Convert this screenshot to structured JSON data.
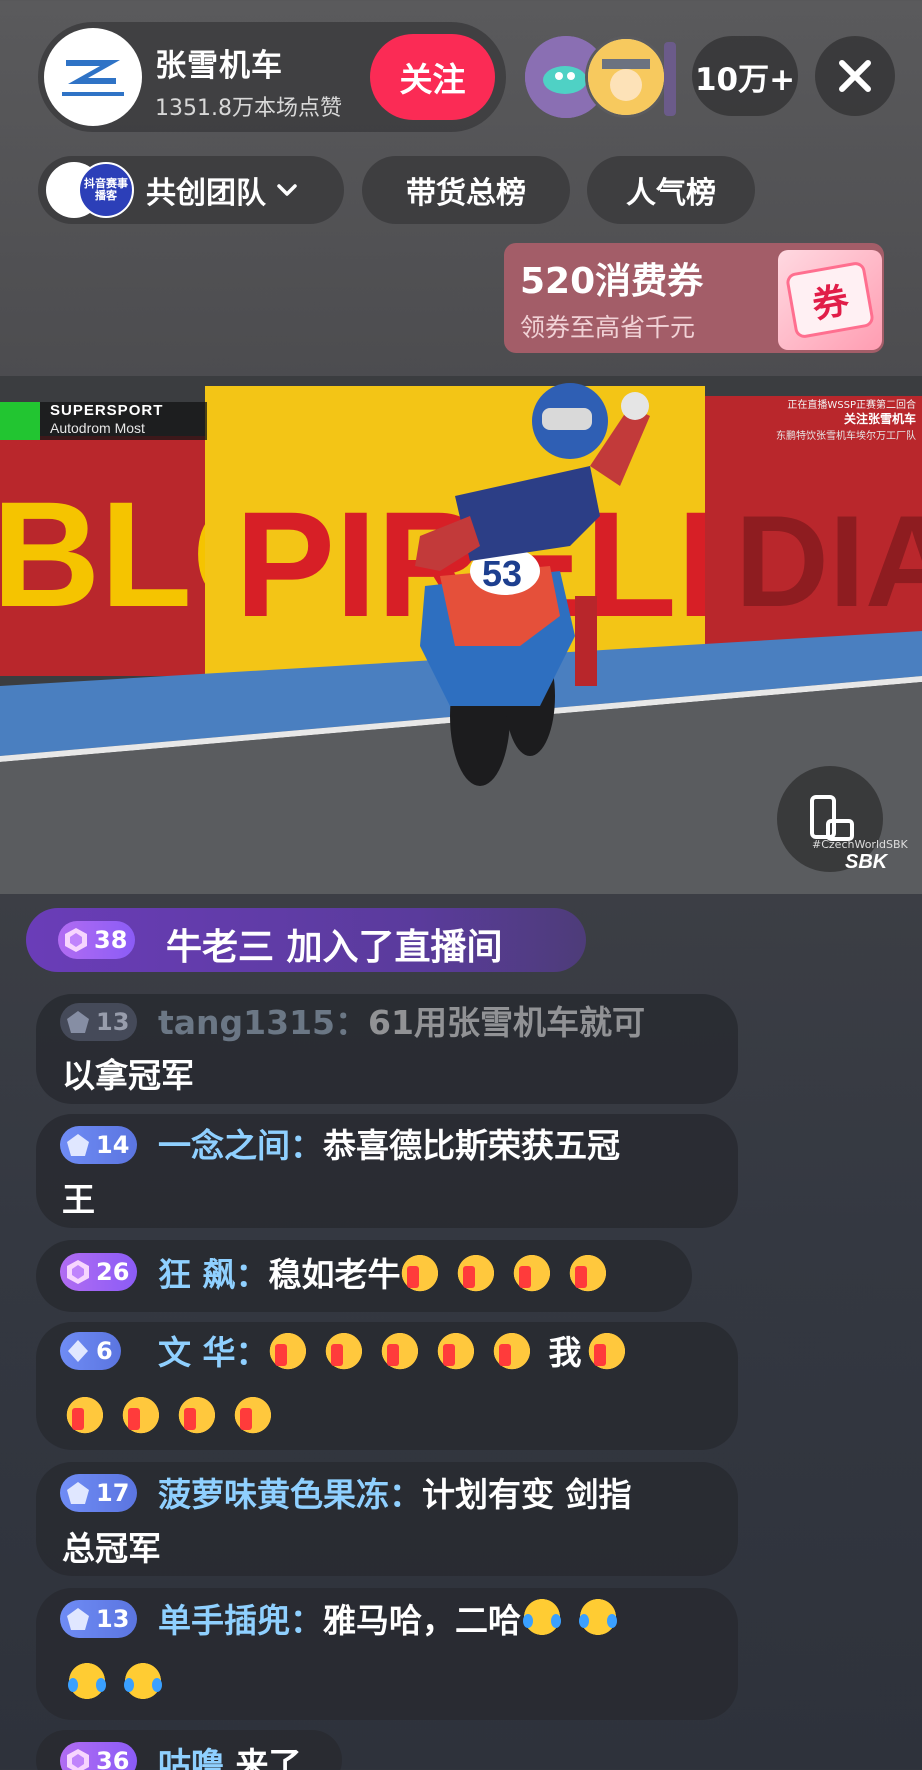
{
  "header": {
    "anchor_name": "张雪机车",
    "anchor_likes": "1351.8万本场点赞",
    "follow_label": "关注",
    "viewer_count": "10万+"
  },
  "tabs": {
    "team_label": "共创团队",
    "team_badge": "抖音赛事播客",
    "goods_label": "带货总榜",
    "popularity_label": "人气榜"
  },
  "coupon": {
    "title": "520消费券",
    "subtitle": "领券至高省千元",
    "icon_text": "券"
  },
  "video": {
    "series_title": "SUPERSPORT",
    "series_venue": "Autodrom Most",
    "overlay_line1": "正在直播WSSP正赛第二回合",
    "overlay_line2": "关注张雪机车",
    "overlay_line3": "东鹏特饮张雪机车埃尔万工厂队",
    "bike_number": "53",
    "sbk_hashtag": "#CzechWorldSBK",
    "sbk_logo": "SBK",
    "banner_left": "BLO",
    "banner_center": "PIRELLI",
    "banner_right": "DIAB"
  },
  "chat": {
    "join": {
      "level": "38",
      "text": "牛老三 加入了直播间"
    },
    "messages": [
      {
        "level": "13",
        "user": "tang1315：",
        "line1": "61用张雪机车就可",
        "line2": "以拿冠军"
      },
      {
        "level": "14",
        "user": "一念之间：",
        "line1": "恭喜德比斯荣获五冠",
        "line2": "王"
      },
      {
        "level": "26",
        "user": "狂 飙：",
        "text": "稳如老牛"
      },
      {
        "level": "6",
        "user": "文 华：",
        "mid_text": "我"
      },
      {
        "level": "17",
        "user": "菠萝味黄色果冻：",
        "line1": "计划有变  剑指",
        "line2": "总冠军"
      },
      {
        "level": "13",
        "user": "单手插兜：",
        "text": "雅马哈，二哈"
      },
      {
        "level": "36",
        "user": "咕噜",
        "text": "来了"
      }
    ]
  },
  "colors": {
    "follow": "#fb2b55",
    "username": "#8fd0ff",
    "badge_purple": "#8b5cf6",
    "badge_blue": "#5b75e0",
    "coupon_bg": "#a35d68"
  },
  "icons": {
    "close": "close-icon",
    "chevron": "chevron-down-icon",
    "rotate": "screen-rotate-icon",
    "gem": "gem-icon"
  }
}
